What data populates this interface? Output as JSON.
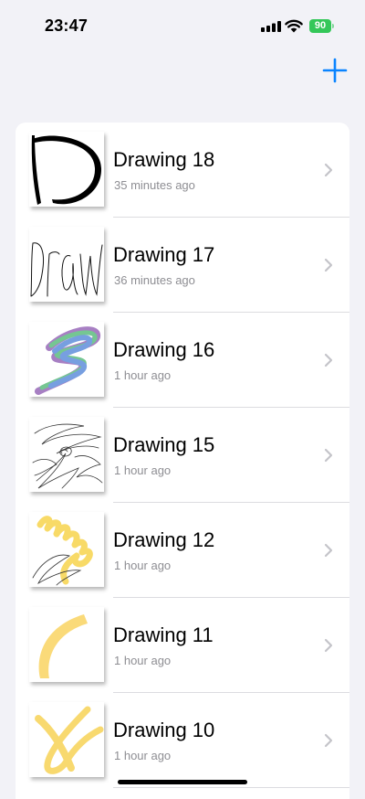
{
  "status_bar": {
    "time": "23:47",
    "battery": "90"
  },
  "toolbar": {
    "add_icon": "plus-icon",
    "accent": "#0a84ff"
  },
  "drawings": [
    {
      "title": "Drawing 18",
      "subtitle": "35 minutes ago"
    },
    {
      "title": "Drawing 17",
      "subtitle": "36 minutes ago"
    },
    {
      "title": "Drawing 16",
      "subtitle": "1 hour ago"
    },
    {
      "title": "Drawing 15",
      "subtitle": "1 hour ago"
    },
    {
      "title": "Drawing 12",
      "subtitle": "1 hour ago"
    },
    {
      "title": "Drawing 11",
      "subtitle": "1 hour ago"
    },
    {
      "title": "Drawing 10",
      "subtitle": "1 hour ago"
    }
  ],
  "colors": {
    "background": "#f2f2f7",
    "secondary_text": "#8e8e93",
    "chevron": "#c4c4c9",
    "battery": "#34c759"
  }
}
